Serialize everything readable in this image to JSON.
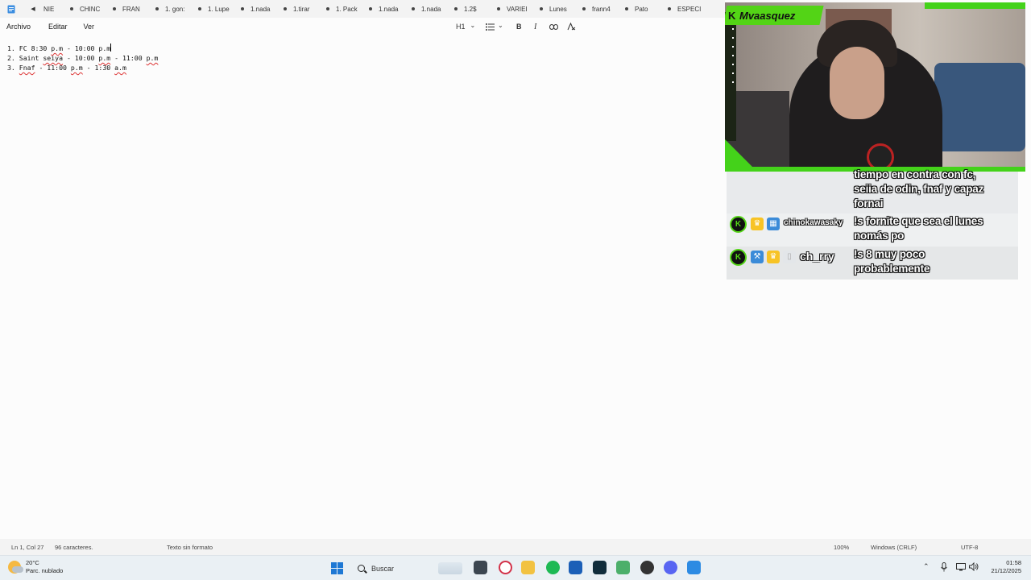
{
  "notepad": {
    "tab_scroll_left": "◀",
    "tabs": [
      "NIE",
      "CHINC",
      "FRAN",
      "1. gon:",
      "1. Lupe",
      "1.nada",
      "1.tirar",
      "1. Pack",
      "1.nada",
      "1.nada",
      "1.2$",
      "VARIEI",
      "Lunes",
      "frann4",
      "Pato",
      "ESPECI"
    ],
    "menu": {
      "file": "Archivo",
      "edit": "Editar",
      "view": "Ver"
    },
    "format_toolbar": {
      "heading": "H1",
      "heading_chevron": "⌄",
      "list_chevron": "⌄",
      "bold": "B",
      "italic": "I"
    },
    "lines": [
      {
        "num": "1.",
        "parts": [
          "FC 8:30 ",
          "p.m",
          " - 10:00 p.m"
        ]
      },
      {
        "num": "2.",
        "parts": [
          "Saint ",
          "seiya",
          " - 10:00 ",
          "p.m",
          " - 11:00 ",
          "p.m"
        ]
      },
      {
        "num": "3.",
        "parts": [
          "Fnaf",
          " - 11:00 ",
          "p.m",
          " - 1:30 ",
          "a.m"
        ]
      }
    ]
  },
  "status": {
    "position": "Ln 1, Col 27",
    "chars": "96 caracteres.",
    "format": "Texto sin formato",
    "zoom": "100%",
    "line_ending": "Windows (CRLF)",
    "encoding": "UTF-8"
  },
  "taskbar": {
    "temperature": "20°C",
    "weather_desc": "Parc. nublado",
    "search_placeholder": "Buscar",
    "time": "01:58",
    "date": "21/12/2025",
    "tray_chevron": "⌃"
  },
  "stream": {
    "platform_logo": "K",
    "streamer_name": "Mvaasquez",
    "chat": [
      {
        "text_lines": [
          "tiempo en contra con fc,",
          "seiia de odin, fnaf y capaz",
          "fornai"
        ]
      },
      {
        "username": "chinokawasaky",
        "text_lines": [
          "!s fornite que sea el lunes",
          "nomás po"
        ]
      },
      {
        "username": "ch_rry",
        "text_lines": [
          "!s 8 muy poco",
          "probablemente"
        ]
      }
    ]
  },
  "colors": {
    "kick_green": "#53d416",
    "accent_blue": "#1e78d4",
    "spell_error": "#d33"
  }
}
